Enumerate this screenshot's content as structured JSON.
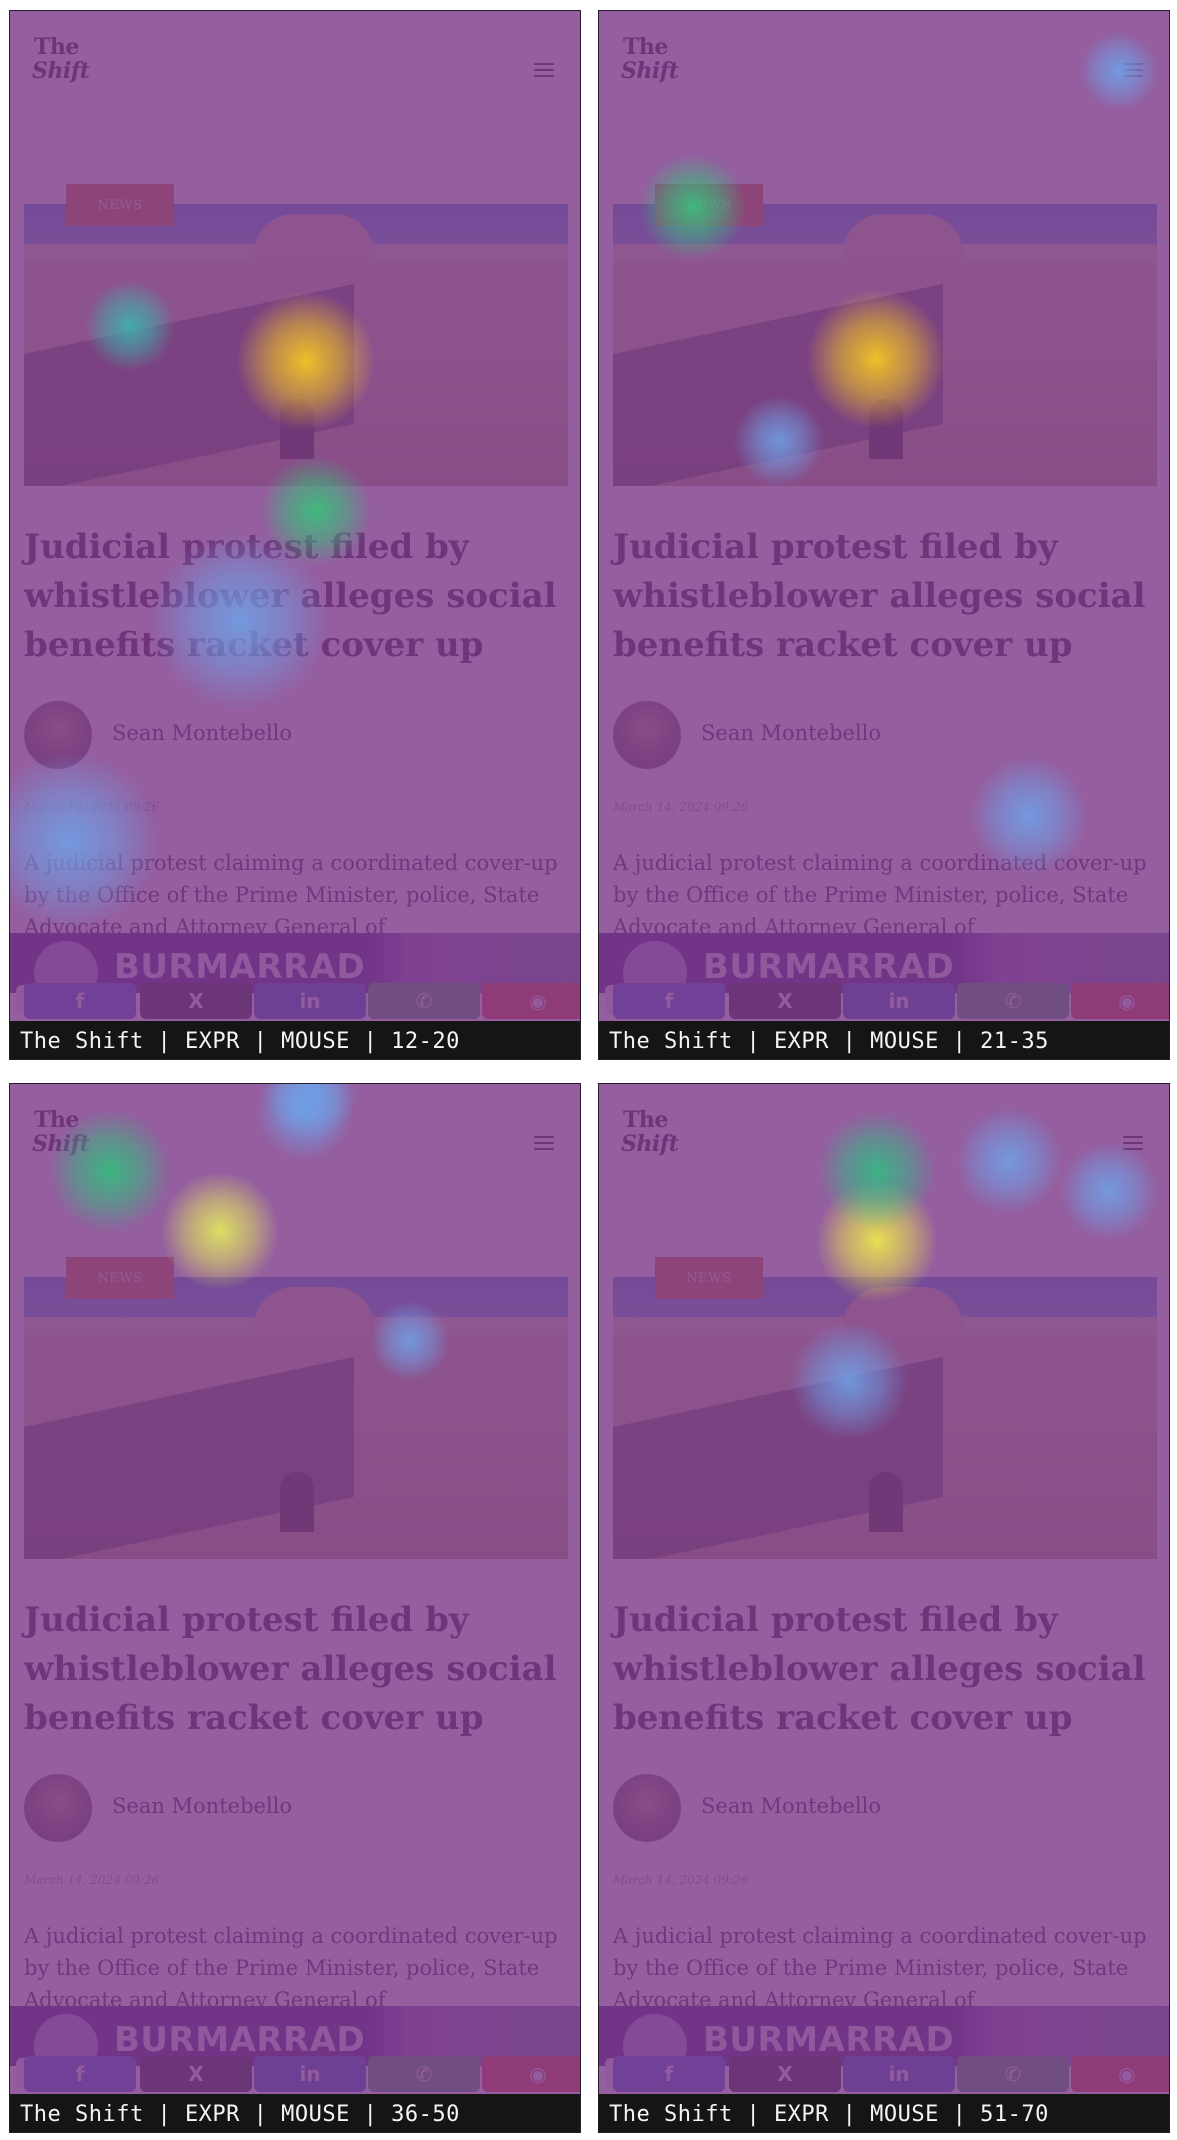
{
  "panels": [
    {
      "caption": "The Shift | EXPR | MOUSE | 12-20",
      "blobs": [
        {
          "color": "#ffd21a",
          "mode": "hot"
        },
        {
          "color": "#32c777",
          "mode": "warm"
        },
        {
          "color": "#39b8b0",
          "mode": "cool"
        },
        {
          "color": "#6fa2e8",
          "mode": "faint"
        }
      ]
    },
    {
      "caption": "The Shift | EXPR | MOUSE | 21-35",
      "blobs": [
        {
          "color": "#ffd21a",
          "mode": "hot"
        },
        {
          "color": "#33c77a",
          "mode": "warm"
        },
        {
          "color": "#6fa2e8",
          "mode": "faint"
        }
      ]
    },
    {
      "caption": "The Shift | EXPR | MOUSE | 36-50",
      "blobs": [
        {
          "color": "#e8f15a",
          "mode": "hot"
        },
        {
          "color": "#2ec27d",
          "mode": "warm"
        },
        {
          "color": "#6fa2e8",
          "mode": "faint"
        }
      ]
    },
    {
      "caption": "The Shift | EXPR | MOUSE | 51-70",
      "blobs": [
        {
          "color": "#f4f246",
          "mode": "hot"
        },
        {
          "color": "#2fbf84",
          "mode": "warm"
        },
        {
          "color": "#6fa2e8",
          "mode": "faint"
        }
      ]
    }
  ],
  "site": {
    "logo_line1": "The",
    "logo_line2": "Shift",
    "badge": "NEWS",
    "headline": "Judicial protest filed by whistleblower alleges social benefits racket cover up",
    "author": "Sean Montebello",
    "date": "March 14, 2024 09:26",
    "excerpt": "A judicial protest claiming a coordinated cover-up by the Office of the Prime Minister, police, State Advocate and Attorney General of",
    "ad_brand": "BURMARRAD",
    "share": [
      {
        "name": "facebook",
        "glyph": "f",
        "color": "#3f5fd6"
      },
      {
        "name": "x",
        "glyph": "X",
        "color": "#1e1e2a"
      },
      {
        "name": "linkedin",
        "glyph": "in",
        "color": "#3058c2"
      },
      {
        "name": "whatsapp",
        "glyph": "✆",
        "color": "#3fa85a"
      },
      {
        "name": "reddit",
        "glyph": "◉",
        "color": "#e23c2a"
      }
    ]
  }
}
